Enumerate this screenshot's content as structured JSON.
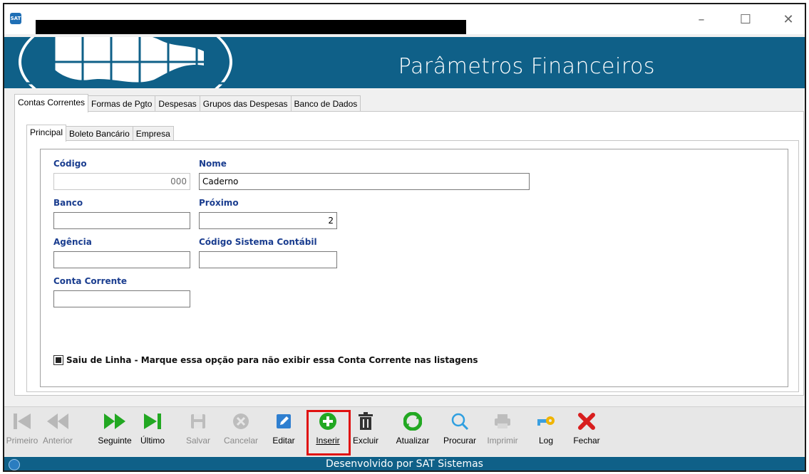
{
  "window": {
    "app_icon": "sat-logo-icon",
    "controls": [
      "minimize-icon",
      "maximize-icon",
      "close-icon"
    ]
  },
  "header": {
    "title": "Parâmetros Financeiros",
    "bg_color": "#0f6088"
  },
  "tabs_main": [
    "Contas Correntes",
    "Formas de Pgto",
    "Despesas",
    "Grupos das Despesas",
    "Banco de Dados"
  ],
  "tabs_main_active": "Contas Correntes",
  "tabs_sub": [
    "Principal",
    "Boleto Bancário",
    "Empresa"
  ],
  "tabs_sub_active": "Principal",
  "form": {
    "codigo_label": "Código",
    "codigo_value": "000",
    "nome_label": "Nome",
    "nome_value": "Caderno",
    "banco_label": "Banco",
    "banco_value": "",
    "proximo_label": "Próximo",
    "proximo_value": "2",
    "agencia_label": "Agência",
    "agencia_value": "",
    "codigo_contabil_label": "Código Sistema Contábil",
    "codigo_contabil_value": "",
    "conta_corrente_label": "Conta Corrente",
    "conta_corrente_value": "",
    "saiu_linha_label": "Saiu de Linha - Marque essa opção para não exibir essa Conta Corrente nas listagens",
    "saiu_linha_checked": true,
    "label_color": "#1a3d8f"
  },
  "toolbar": {
    "primeiro": "Primeiro",
    "anterior": "Anterior",
    "seguinte": "Seguinte",
    "ultimo": "Último",
    "salvar": "Salvar",
    "cancelar": "Cancelar",
    "editar": "Editar",
    "inserir": "Inserir",
    "excluir": "Excluir",
    "atualizar": "Atualizar",
    "procurar": "Procurar",
    "imprimir": "Imprimir",
    "log": "Log",
    "fechar": "Fechar",
    "highlight_color": "#e01010"
  },
  "status": {
    "text": "Desenvolvido por SAT Sistemas"
  }
}
